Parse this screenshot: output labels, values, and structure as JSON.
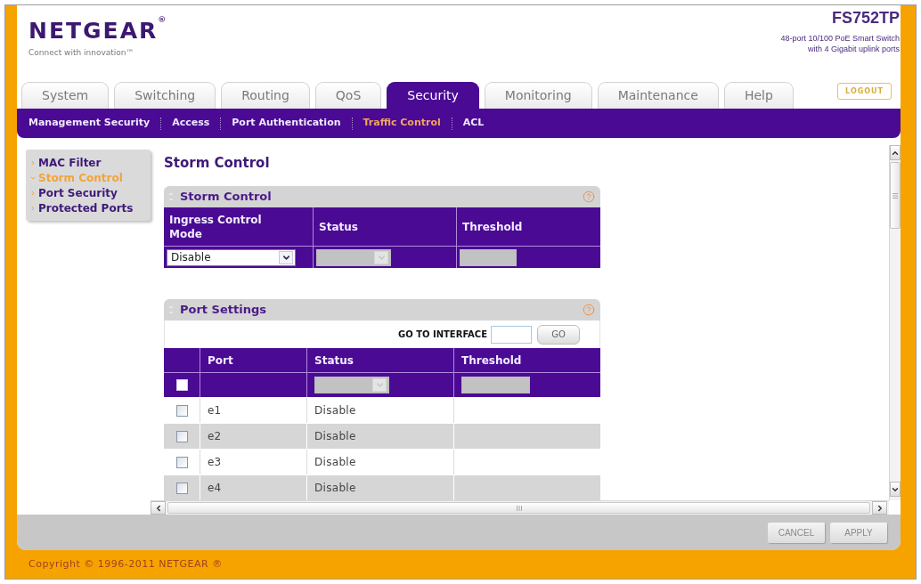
{
  "header": {
    "logo": "NETGEAR$^{®}$",
    "tagline": "Connect with innovation™",
    "model": "FS752TP",
    "description": [
      "48-port 10/100 PoE Smart Switch",
      "with 4 Gigabit uplink ports"
    ]
  },
  "tabs": [
    {
      "label": "System",
      "selected": false
    },
    {
      "label": "Switching",
      "selected": false
    },
    {
      "label": "Routing",
      "selected": false
    },
    {
      "label": "QoS",
      "selected": false
    },
    {
      "label": "Security",
      "selected": true
    },
    {
      "label": "Monitoring",
      "selected": false
    },
    {
      "label": "Maintenance",
      "selected": false
    },
    {
      "label": "Help",
      "selected": false
    }
  ],
  "logout_button": {
    "label": "LOGOUT"
  },
  "subnav": [
    {
      "label": "Management Security",
      "selected": false
    },
    {
      "label": "Access",
      "selected": false
    },
    {
      "label": "Port Authentication",
      "selected": false
    },
    {
      "label": "Traffic Control",
      "selected": true
    },
    {
      "label": "ACL",
      "selected": false
    }
  ],
  "sidebar": {
    "items": [
      {
        "label": "MAC Filter",
        "selected": false
      },
      {
        "label": "Storm Control",
        "selected": true
      },
      {
        "label": "Port Security",
        "selected": false
      },
      {
        "label": "Protected Ports",
        "selected": false
      }
    ]
  },
  "page_title": "Storm Control",
  "storm_control": {
    "title": "Storm Control",
    "columns": [
      "Ingress Control Mode",
      "Status",
      "Threshold"
    ],
    "fields": [
      {
        "kind": "select",
        "value": "Disable",
        "disabled": false
      },
      {
        "kind": "select",
        "disabled": true
      },
      {
        "kind": "text",
        "disabled": true
      }
    ]
  },
  "port_settings": {
    "title": "Port Settings",
    "go_to_interface": {
      "label": "GO TO INTERFACE",
      "button": "GO"
    },
    "columns": [
      "Port",
      "Status",
      "Threshold"
    ],
    "bulk_row": {
      "checked": false,
      "fields": [
        {
          "kind": "select",
          "disabled": true
        },
        {
          "kind": "text",
          "disabled": true
        }
      ]
    },
    "rows": [
      {
        "checked": false,
        "port": "e1",
        "status": "Disable"
      },
      {
        "checked": false,
        "port": "e2",
        "status": "Disable"
      },
      {
        "checked": false,
        "port": "e3",
        "status": "Disable"
      },
      {
        "checked": false,
        "port": "e4",
        "status": "Disable"
      }
    ]
  },
  "buttons": [
    {
      "label": "CANCEL"
    },
    {
      "label": "APPLY"
    }
  ],
  "copyright": "Copyright © 1996-2011 NETGEAR ®"
}
